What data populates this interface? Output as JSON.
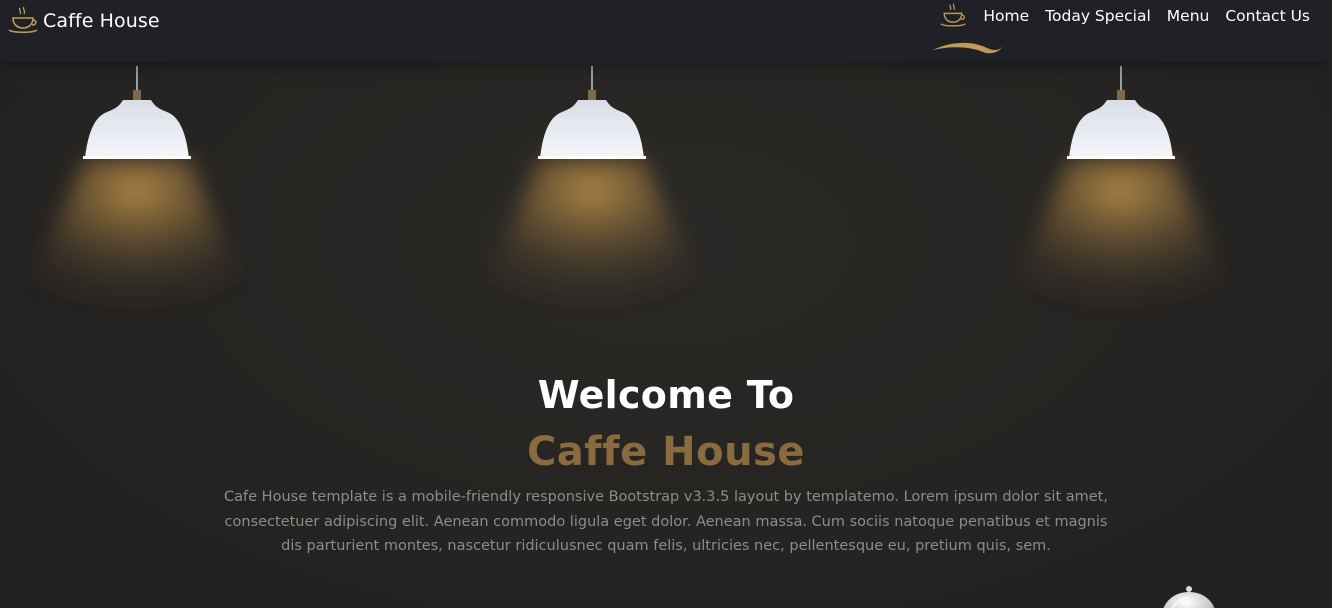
{
  "brand": {
    "name": "Caffe House",
    "icon": "coffee-cup-icon"
  },
  "nav": {
    "items": [
      {
        "label": "Home",
        "active": true
      },
      {
        "label": "Today Special"
      },
      {
        "label": "Menu"
      },
      {
        "label": "Contact Us"
      }
    ],
    "active_icon": "coffee-cup-icon",
    "accent_color": "#c19a5b"
  },
  "hero": {
    "title_line1": "Welcome To",
    "title_line2": "Caffe House",
    "description": "Cafe House template is a mobile-friendly responsive Bootstrap v3.3.5 layout by templatemo. Lorem ipsum dolor sit amet, consectetuer adipiscing elit. Aenean commodo ligula eget dolor. Aenean massa. Cum sociis natoque penatibus et magnis dis parturient montes, nascetur ridiculusnec quam felis, ultricies nec, pellentesque eu, pretium quis, sem."
  },
  "colors": {
    "background": "#272523",
    "navbar": "#202126",
    "title_accent": "#8a6a3f",
    "text_muted": "#8e8c89",
    "lamp_glow": "#b58a45"
  }
}
